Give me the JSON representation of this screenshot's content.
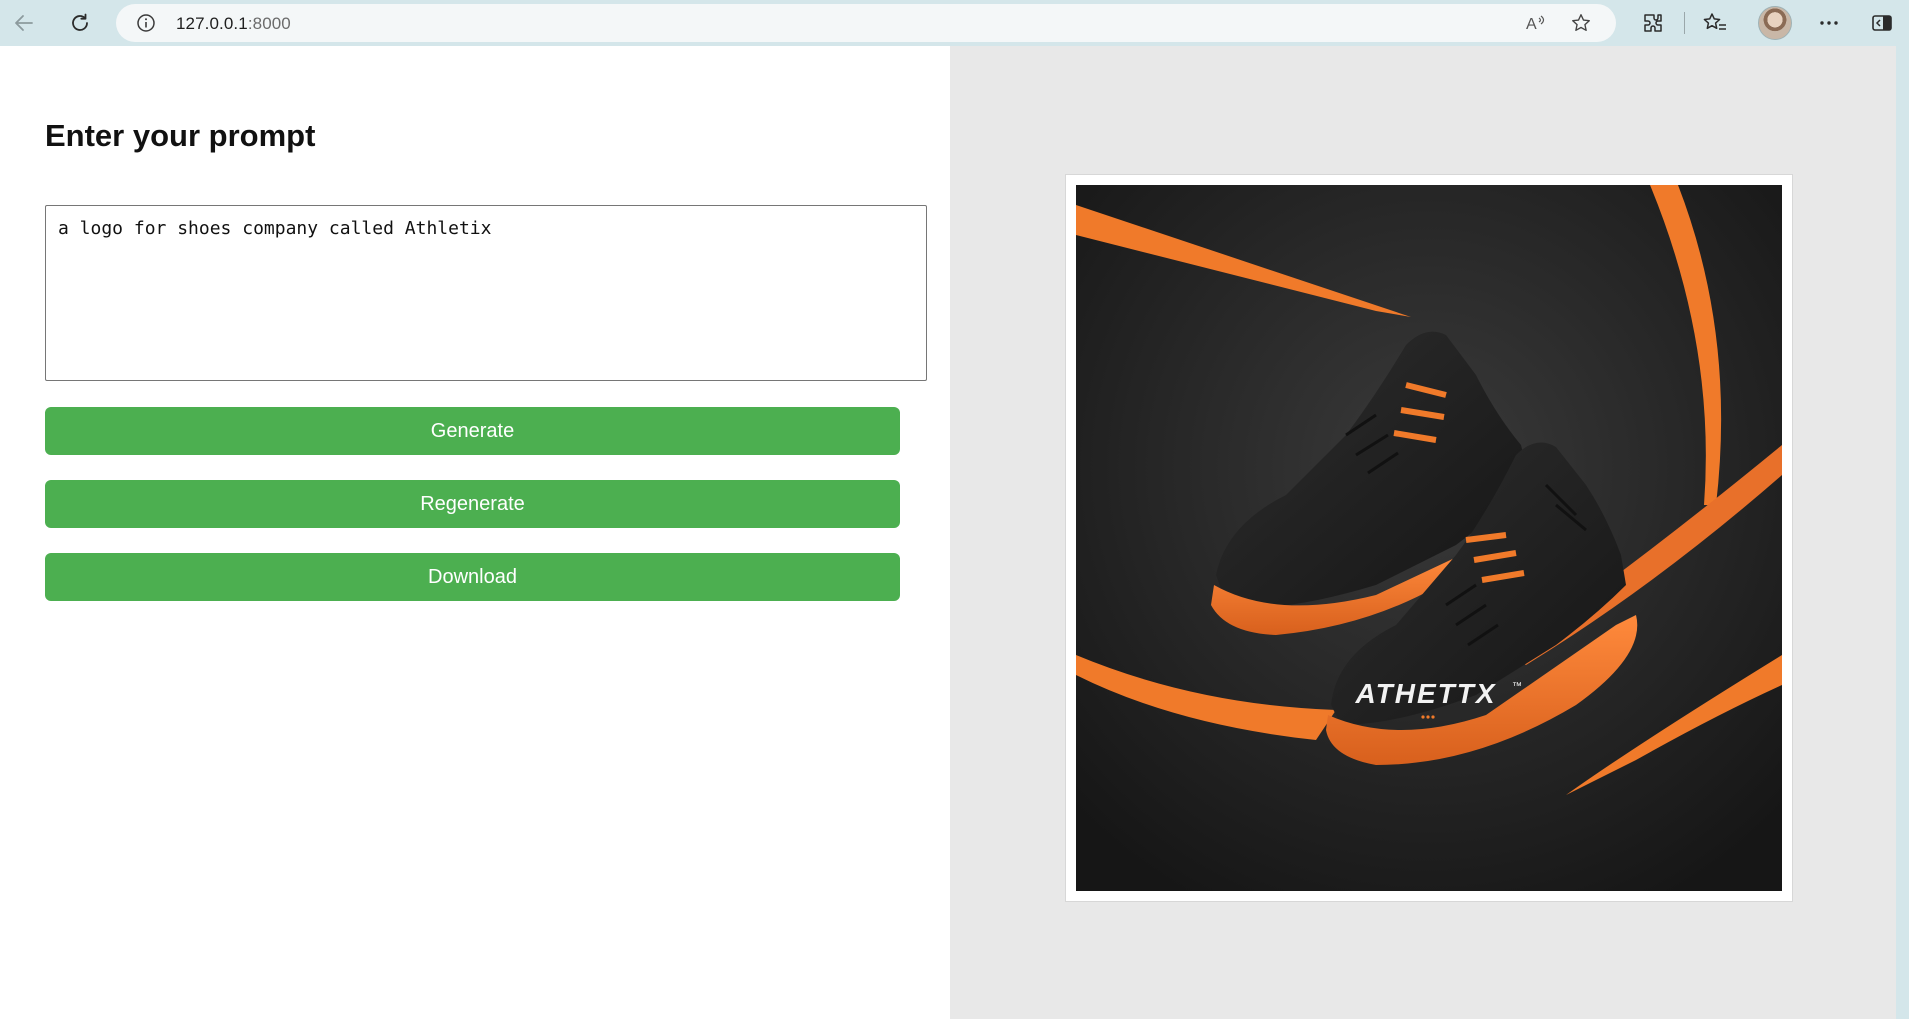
{
  "browser": {
    "url_host": "127.0.0.1",
    "url_port": ":8000"
  },
  "main": {
    "title": "Enter your prompt",
    "prompt_value": "a logo for shoes company called Athletix",
    "buttons": {
      "generate": "Generate",
      "regenerate": "Regenerate",
      "download": "Download"
    }
  },
  "generated_image": {
    "brand_text": "ATHETTX",
    "trademark": "™",
    "colors": {
      "background": "#1c1c1c",
      "accent": "#f07a2a",
      "shoe": "#1f1f1f"
    }
  },
  "icons": {
    "back": "back-arrow-icon",
    "reload": "reload-icon",
    "info": "info-icon",
    "read_aloud": "read-aloud-icon",
    "favorite": "star-icon",
    "extensions": "extensions-icon",
    "favorites": "favorites-icon",
    "more": "more-icon",
    "sidebar": "sidebar-icon"
  },
  "accent_button_color": "#4caf50"
}
